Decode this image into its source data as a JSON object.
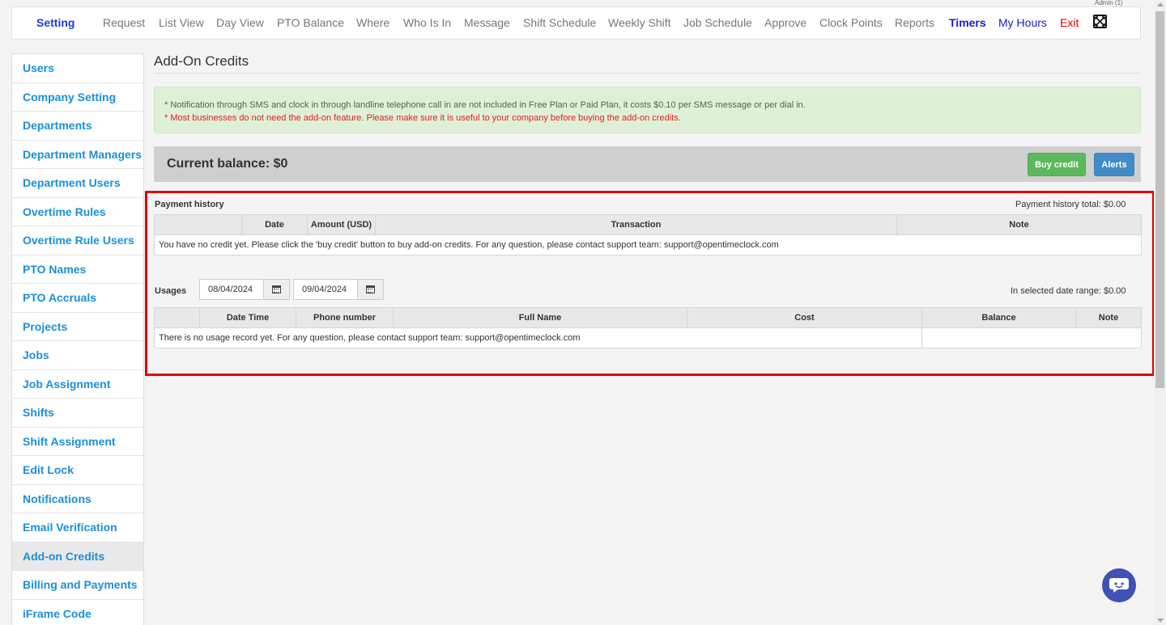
{
  "header": {
    "admin_label": "Admin (1)",
    "nav": [
      {
        "label": "Setting"
      },
      {
        "label": "Request"
      },
      {
        "label": "List View"
      },
      {
        "label": "Day View"
      },
      {
        "label": "PTO Balance"
      },
      {
        "label": "Where"
      },
      {
        "label": "Who Is In"
      },
      {
        "label": "Message"
      },
      {
        "label": "Shift Schedule"
      },
      {
        "label": "Weekly Shift"
      },
      {
        "label": "Job Schedule"
      },
      {
        "label": "Approve"
      },
      {
        "label": "Clock Points"
      },
      {
        "label": "Reports"
      },
      {
        "label": "Timers"
      },
      {
        "label": "My Hours"
      },
      {
        "label": "Exit"
      }
    ],
    "fullscreen_icon": "fullscreen-icon"
  },
  "sidebar": {
    "items": [
      {
        "label": "Users"
      },
      {
        "label": "Company Setting"
      },
      {
        "label": "Departments"
      },
      {
        "label": "Department Managers"
      },
      {
        "label": "Department Users"
      },
      {
        "label": "Overtime Rules"
      },
      {
        "label": "Overtime Rule Users"
      },
      {
        "label": "PTO Names"
      },
      {
        "label": "PTO Accruals"
      },
      {
        "label": "Projects"
      },
      {
        "label": "Jobs"
      },
      {
        "label": "Job Assignment"
      },
      {
        "label": "Shifts"
      },
      {
        "label": "Shift Assignment"
      },
      {
        "label": "Edit Lock"
      },
      {
        "label": "Notifications"
      },
      {
        "label": "Email Verification"
      },
      {
        "label": "Add-on Credits"
      },
      {
        "label": "Billing and Payments"
      },
      {
        "label": "iFrame Code"
      }
    ],
    "active": "Add-on Credits"
  },
  "main": {
    "title": "Add-On Credits",
    "notice_line1": "* Notification through SMS and clock in through landline telephone call in are not included in Free Plan or Paid Plan, it costs $0.10 per SMS message or per dial in.",
    "notice_line2": "* Most businesses do not need the add-on feature. Please make sure it is useful to your company before buying the add-on credits.",
    "balance_label": "Current balance: $0",
    "buy_credit_label": "Buy credit",
    "alerts_label": "Alerts"
  },
  "payment_history": {
    "label": "Payment history",
    "total_label": "Payment history total: $0.00",
    "columns": [
      "",
      "Date",
      "Amount (USD)",
      "Transaction",
      "Note"
    ],
    "empty_message": "You have no credit yet. Please click the 'buy credit' button to buy add-on credits. For any question, please contact support team: support@opentimeclock.com"
  },
  "usages": {
    "label": "Usages",
    "from_date": "08/04/2024",
    "to_date": "09/04/2024",
    "range_total_label": "In selected date range: $0.00",
    "columns": [
      "",
      "Date Time",
      "Phone number",
      "Full Name",
      "Cost",
      "Balance",
      "Note"
    ],
    "empty_message": "There is no usage record yet. For any question, please contact support team: support@opentimeclock.com"
  },
  "colors": {
    "accent_blue": "#1a8fd8",
    "notice_bg": "#dff0d8",
    "warning_red": "#e02020",
    "buy_green": "#5cb85c",
    "alerts_blue": "#428bca",
    "highlight_red": "#e30000",
    "chat_bg": "#3f51b5"
  }
}
